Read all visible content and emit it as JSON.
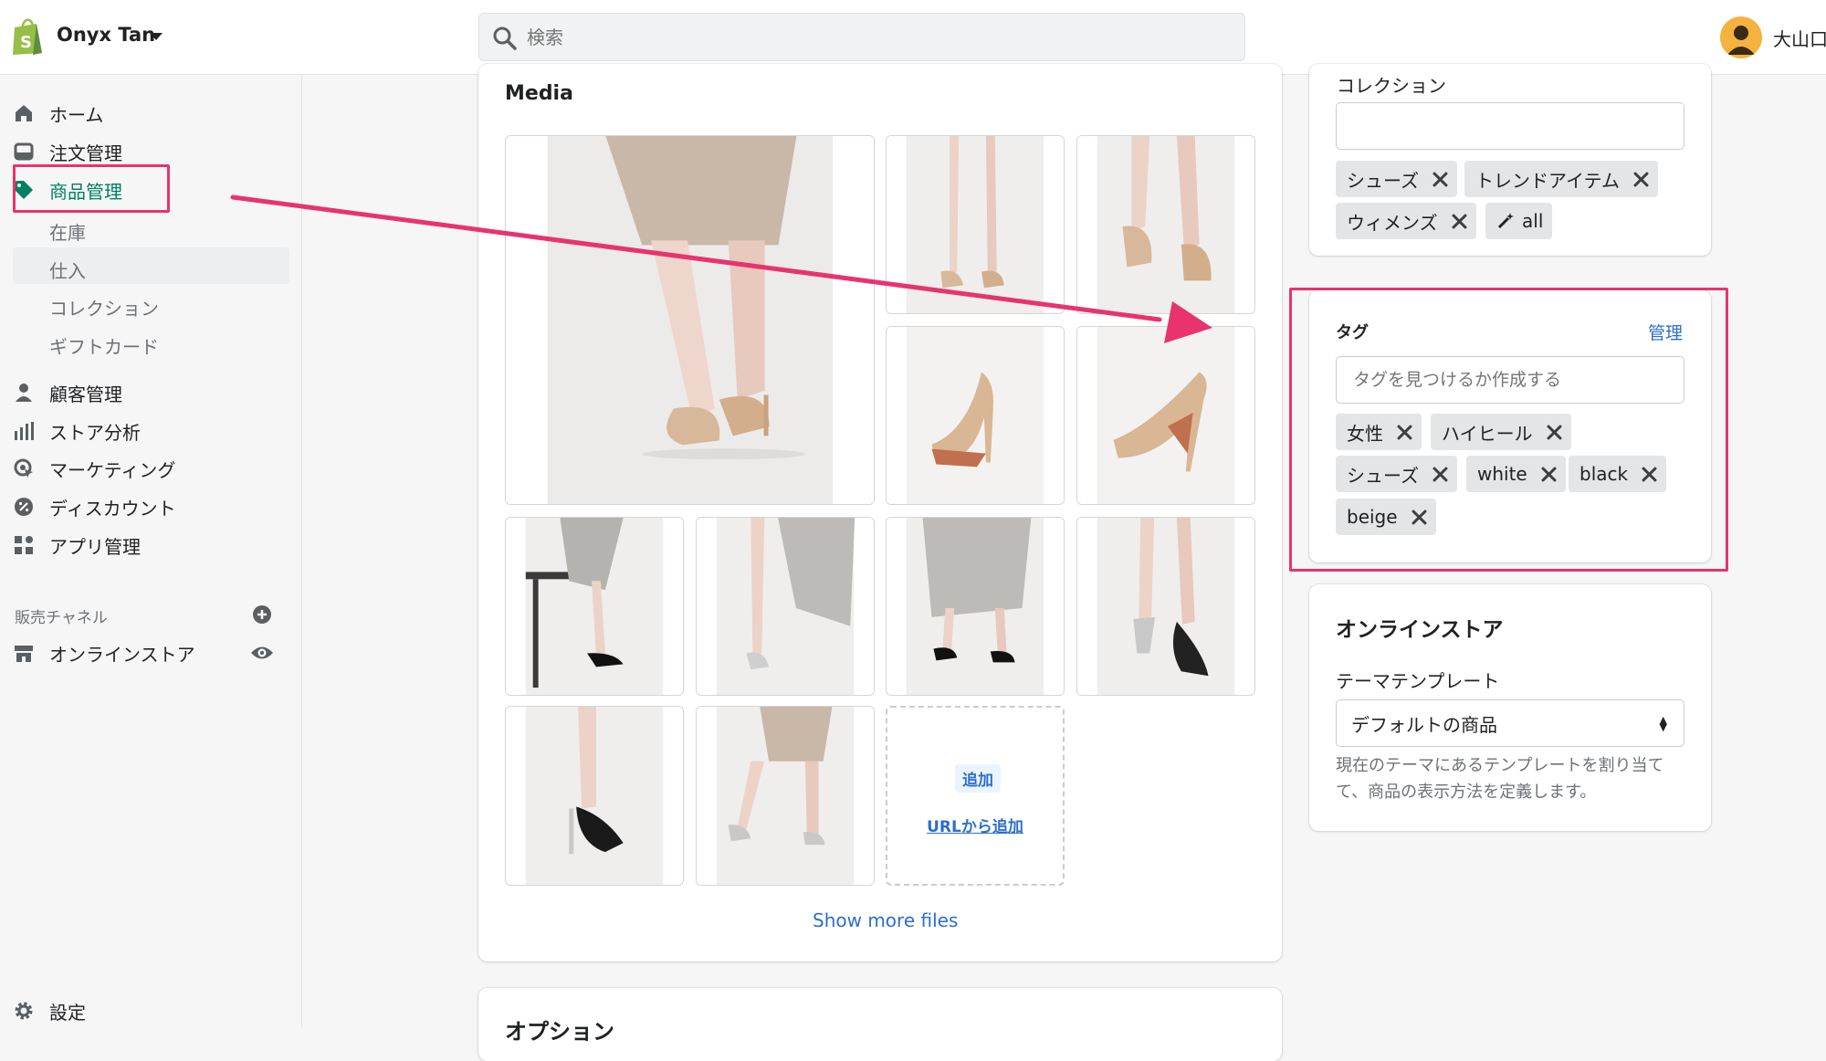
{
  "header": {
    "store_name": "Onyx Tan",
    "search_placeholder": "検索",
    "user_name": "大山口",
    "icons": [
      "shopify-logo-icon",
      "caret-down-icon",
      "search-icon",
      "avatar-icon"
    ]
  },
  "sidebar": {
    "items": [
      {
        "label": "ホーム",
        "icon": "home-icon"
      },
      {
        "label": "注文管理",
        "icon": "orders-icon"
      },
      {
        "label": "商品管理",
        "icon": "tag-icon",
        "active": true
      },
      {
        "label": "顧客管理",
        "icon": "customer-icon"
      },
      {
        "label": "ストア分析",
        "icon": "analytics-icon"
      },
      {
        "label": "マーケティング",
        "icon": "marketing-icon"
      },
      {
        "label": "ディスカウント",
        "icon": "discount-icon"
      },
      {
        "label": "アプリ管理",
        "icon": "apps-icon"
      }
    ],
    "product_subitems": [
      "在庫",
      "仕入",
      "コレクション",
      "ギフトカード"
    ],
    "channels_label": "販売チャネル",
    "channel_online_store": "オンラインストア",
    "settings_label": "設定"
  },
  "media": {
    "title": "Media",
    "add_button": "追加",
    "add_from_url": "URLから追加",
    "show_more": "Show more files",
    "image_count": 10
  },
  "options_title": "オプション",
  "collections": {
    "label": "コレクション",
    "chips": [
      "シューズ",
      "トレンドアイテム",
      "ウィメンズ",
      "all"
    ]
  },
  "tags": {
    "label": "タグ",
    "manage": "管理",
    "placeholder": "タグを見つけるか作成する",
    "chips": [
      "女性",
      "ハイヒール",
      "シューズ",
      "white",
      "black",
      "beige"
    ]
  },
  "online_store": {
    "title": "オンラインストア",
    "template_label": "テーマテンプレート",
    "template_value": "デフォルトの商品",
    "help": "現在のテーマにあるテンプレートを割り当てて、商品の表示方法を定義します。"
  },
  "colors": {
    "accent": "#2c6ecb",
    "highlight": "#e8336e",
    "brand": "#95bf47",
    "active_nav": "#008060"
  }
}
